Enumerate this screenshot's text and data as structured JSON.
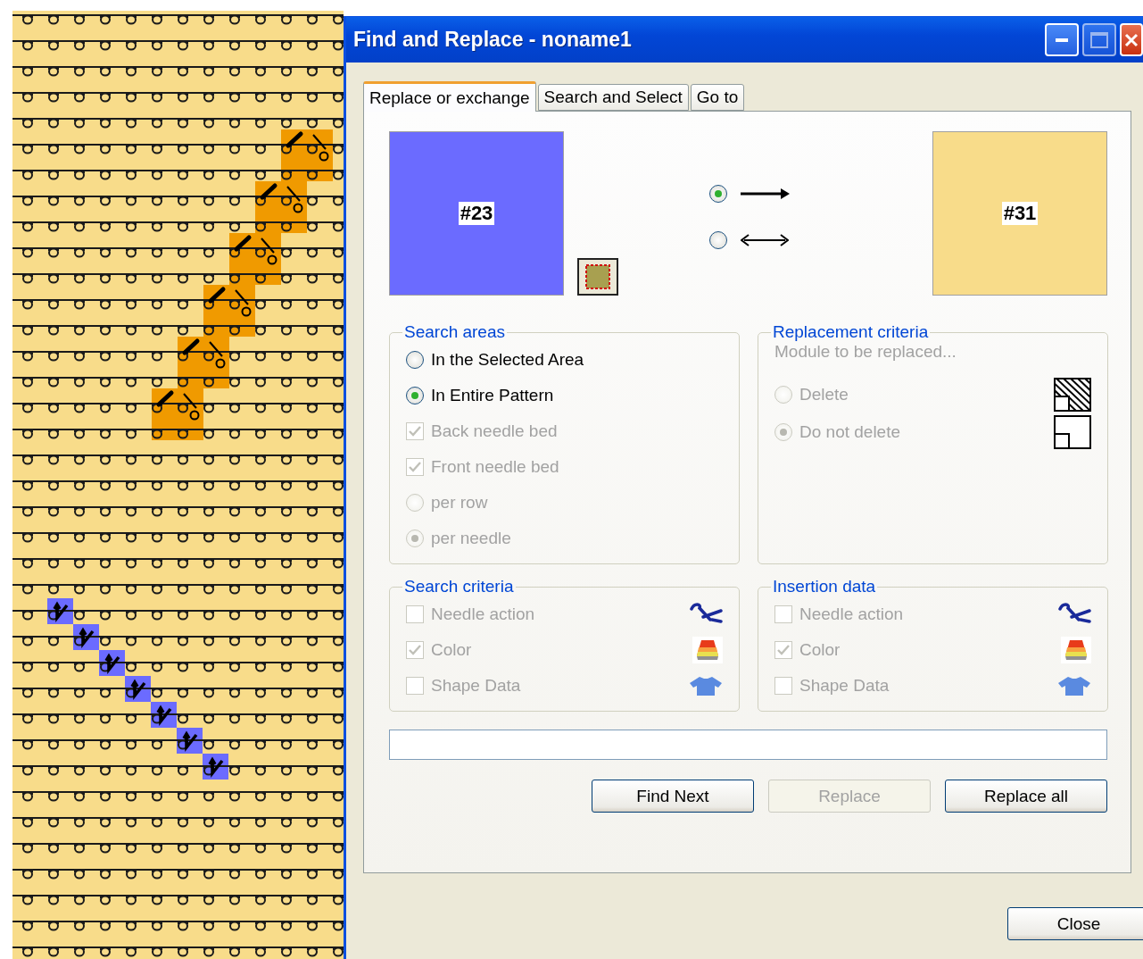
{
  "window": {
    "title": "Find and Replace - noname1"
  },
  "tabs": [
    {
      "label": "Replace or exchange",
      "selected": true
    },
    {
      "label": "Search and Select",
      "selected": false
    },
    {
      "label": "Go to",
      "selected": false
    }
  ],
  "swatches": [
    {
      "label": "#23",
      "color": "#6b6bff"
    },
    {
      "label": "#31",
      "color": "#f8dc8a"
    }
  ],
  "direction": [
    {
      "kind": "one-way",
      "selected": true
    },
    {
      "kind": "exchange",
      "selected": false
    }
  ],
  "search_areas": {
    "title": "Search areas",
    "items": [
      {
        "kind": "radio",
        "label": "In the Selected Area",
        "selected": false,
        "disabled": false
      },
      {
        "kind": "radio",
        "label": "In Entire Pattern",
        "selected": true,
        "disabled": false
      },
      {
        "kind": "checkbox",
        "label": "Back needle bed",
        "checked": true,
        "disabled": true
      },
      {
        "kind": "checkbox",
        "label": "Front needle bed",
        "checked": true,
        "disabled": true
      },
      {
        "kind": "radio",
        "label": "per row",
        "selected": false,
        "disabled": true
      },
      {
        "kind": "radio",
        "label": "per needle",
        "selected": true,
        "disabled": true
      }
    ]
  },
  "replacement_criteria": {
    "title": "Replacement criteria",
    "hint": "Module to be replaced...",
    "items": [
      {
        "kind": "radio",
        "label": "Delete",
        "selected": false,
        "disabled": true
      },
      {
        "kind": "radio",
        "label": "Do not delete",
        "selected": true,
        "disabled": true
      }
    ]
  },
  "search_criteria": {
    "title": "Search criteria",
    "items": [
      {
        "kind": "checkbox",
        "label": "Needle action",
        "checked": false,
        "disabled": true
      },
      {
        "kind": "checkbox",
        "label": "Color",
        "checked": true,
        "disabled": true
      },
      {
        "kind": "checkbox",
        "label": "Shape Data",
        "checked": false,
        "disabled": true
      }
    ]
  },
  "insertion_data": {
    "title": "Insertion data",
    "items": [
      {
        "kind": "checkbox",
        "label": "Needle action",
        "checked": false,
        "disabled": true
      },
      {
        "kind": "checkbox",
        "label": "Color",
        "checked": true,
        "disabled": true
      },
      {
        "kind": "checkbox",
        "label": "Shape Data",
        "checked": false,
        "disabled": true
      }
    ]
  },
  "buttons": [
    {
      "label": "Find Next",
      "disabled": false
    },
    {
      "label": "Replace",
      "disabled": true
    },
    {
      "label": "Replace all",
      "disabled": false
    }
  ],
  "close_button": {
    "label": "Close"
  }
}
